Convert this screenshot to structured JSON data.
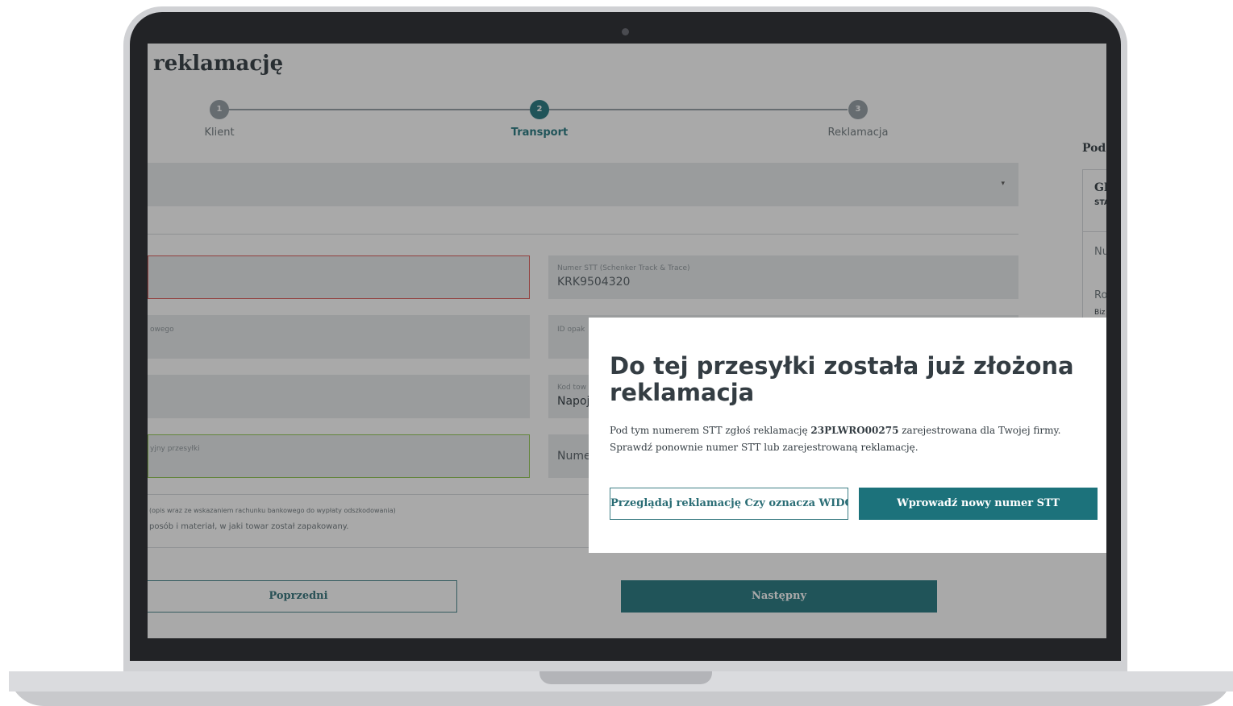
{
  "page": {
    "title": "reklamację"
  },
  "steps": [
    {
      "number": "1",
      "label": "Klient",
      "state": "inactive"
    },
    {
      "number": "2",
      "label": "Transport",
      "state": "active"
    },
    {
      "number": "3",
      "label": "Reklamacja",
      "state": "inactive"
    }
  ],
  "form": {
    "stt_label": "Numer STT (Schenker Track & Trace)",
    "stt_value": "KRK9504320",
    "left_field_2_label": "owego",
    "right_field_2_label": "ID opak",
    "right_field_3_label": "Kod tow",
    "right_field_3_value": "Napoj",
    "left_field_4_label": "yjny przesyłki",
    "right_field_4_value": "Nume",
    "description_label": "(opis wraz ze wskazaniem rachunku bankowego do wypłaty odszkodowania)",
    "description_text": "posób i materiał, w jaki towar został zapakowany."
  },
  "navigation": {
    "prev_label": "Poprzedni",
    "next_label": "Następny"
  },
  "sidebar": {
    "heading": "Pod",
    "card_title": "Gl",
    "card_sub": "STA",
    "item_1": "Nu",
    "item_2": "Ro",
    "item_2_value": "Biz"
  },
  "modal": {
    "title": "Do tej przesyłki została już złożona reklamacja",
    "line1_prefix": "Pod tym numerem STT zgłoś reklamację ",
    "line1_code": "23PLWRO00275",
    "line1_suffix": " zarejestrowana dla Twojej firmy.",
    "line2": "Sprawdź ponownie numer STT lub zarejestrowaną reklamację.",
    "btn_secondary": "Przeglądaj reklamację Czy oznacza WIDOK",
    "btn_primary": "Wprowadź nowy numer STT"
  },
  "colors": {
    "accent": "#1c727b",
    "step_active": "#1c727b",
    "step_inactive": "#8f9aa1",
    "field_error_border": "#d9534f",
    "field_success_border": "#8bc34a"
  }
}
